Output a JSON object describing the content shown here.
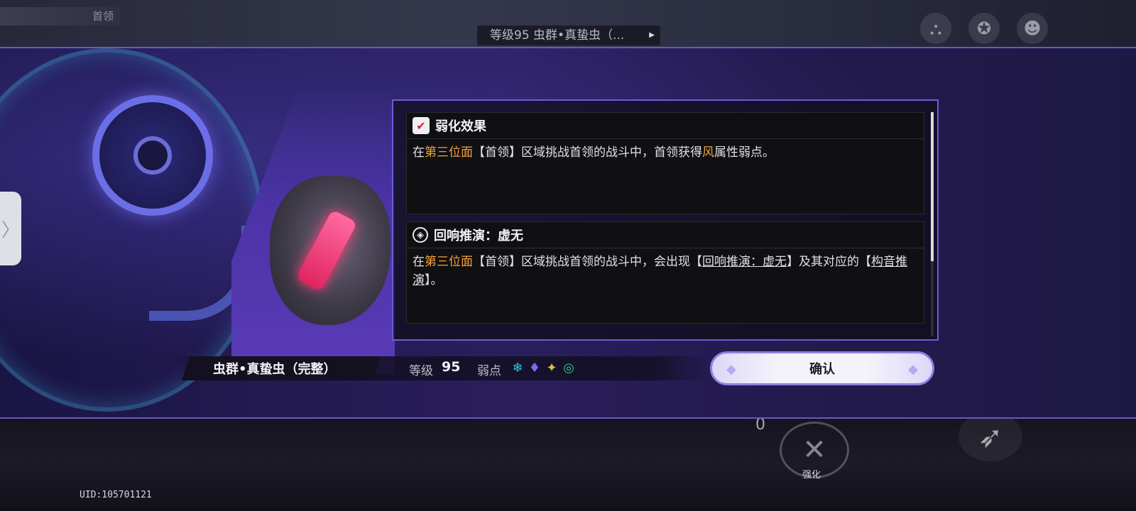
{
  "top_bar": {
    "breadcrumb": "首领",
    "boss_chip": "等级95 虫群•真蛰虫（...",
    "icons": [
      "team-icon",
      "compass-icon",
      "character-icon"
    ]
  },
  "modal": {
    "cards": [
      {
        "icon": "weaken-icon",
        "title": "弱化效果",
        "body_parts": [
          {
            "text": "在",
            "style": "normal"
          },
          {
            "text": "第三位面",
            "style": "highlight"
          },
          {
            "text": "【首领】区域挑战首领的战斗中，首领获得",
            "style": "normal"
          },
          {
            "text": "风",
            "style": "highlight"
          },
          {
            "text": "属性弱点。",
            "style": "normal"
          }
        ]
      },
      {
        "icon": "echo-icon",
        "title": "回响推演：虚无",
        "body_parts": [
          {
            "text": "在",
            "style": "normal"
          },
          {
            "text": "第三位面",
            "style": "highlight"
          },
          {
            "text": "【首领】区域挑战首领的战斗中，会出现【",
            "style": "normal"
          },
          {
            "text": "回响推演：虚无",
            "style": "underline"
          },
          {
            "text": "】及其对应的【",
            "style": "normal"
          },
          {
            "text": "构音推演",
            "style": "underline"
          },
          {
            "text": "】。",
            "style": "normal"
          }
        ]
      }
    ],
    "boss_name": "虫群•真蛰虫（完整）",
    "level_label": "等级",
    "level_value": "95",
    "weakness_label": "弱点",
    "weakness_icons": [
      {
        "name": "ice-icon",
        "glyph": "❄",
        "color": "#36c3d9"
      },
      {
        "name": "imaginary-icon",
        "glyph": "♦",
        "color": "#7b6cf0"
      },
      {
        "name": "quantum-icon",
        "glyph": "✦",
        "color": "#d9c23a"
      },
      {
        "name": "wind-icon",
        "glyph": "◎",
        "color": "#36c98a"
      }
    ],
    "confirm_label": "确认"
  },
  "hud": {
    "uid": "UID:105701121",
    "skill_label": "强化",
    "counter": "0"
  },
  "colors": {
    "accent": "#6d5cd6",
    "highlight": "#f3a23a"
  }
}
